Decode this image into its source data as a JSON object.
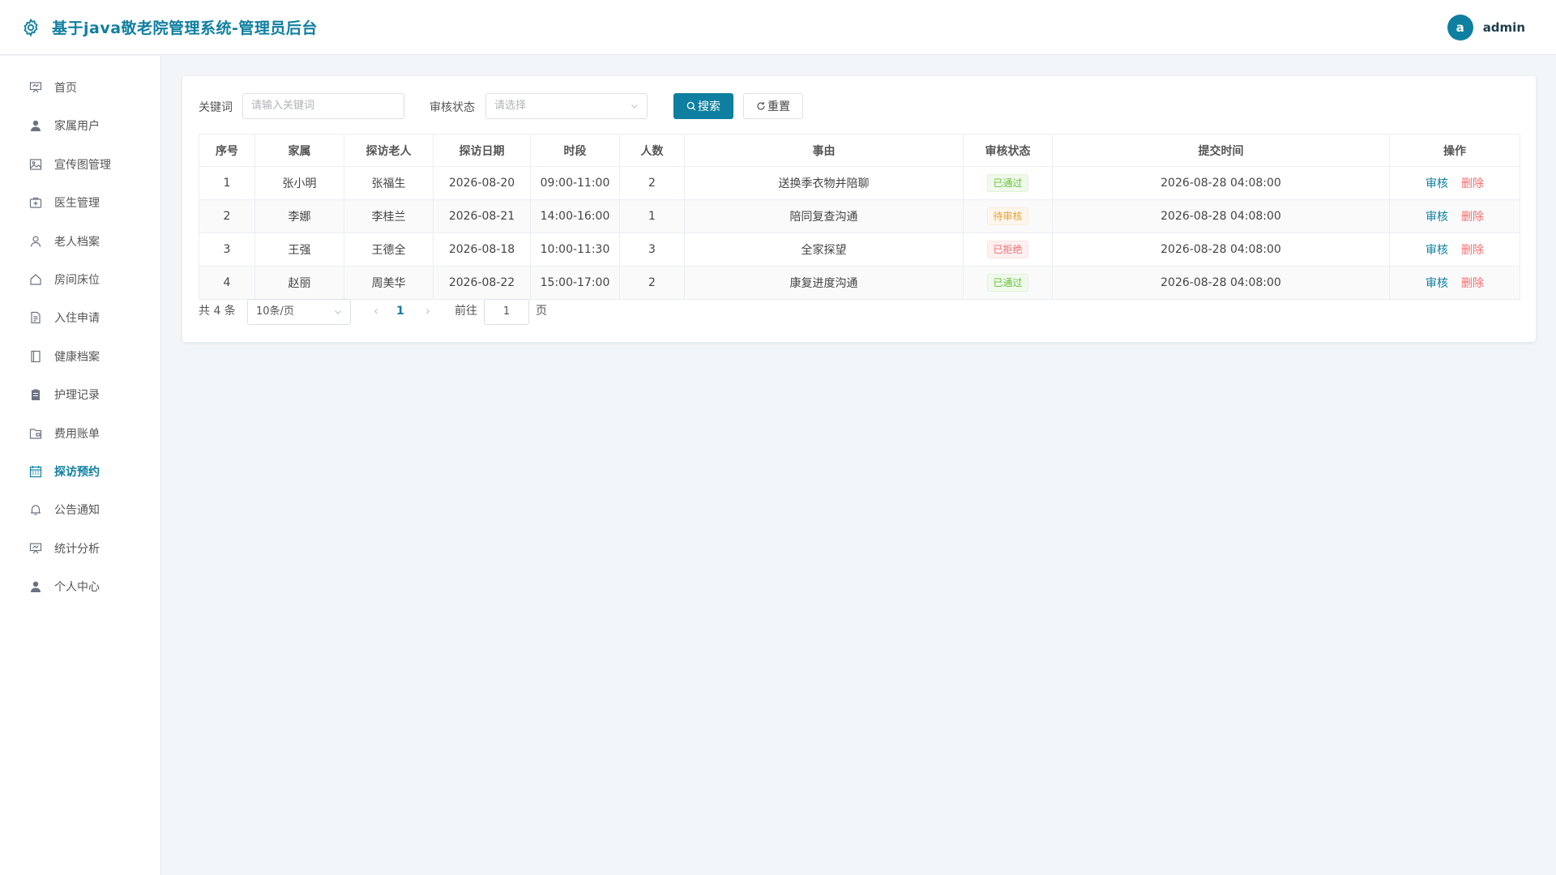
{
  "header": {
    "title": "基于java敬老院管理系统-管理员后台",
    "user_initial": "a",
    "username": "admin"
  },
  "sidebar": {
    "items": [
      {
        "label": "首页",
        "icon": "home-board-icon"
      },
      {
        "label": "家属用户",
        "icon": "user-solid-icon"
      },
      {
        "label": "宣传图管理",
        "icon": "picture-icon"
      },
      {
        "label": "医生管理",
        "icon": "first-aid-kit-icon"
      },
      {
        "label": "老人档案",
        "icon": "user-icon"
      },
      {
        "label": "房间床位",
        "icon": "house-icon"
      },
      {
        "label": "入住申请",
        "icon": "document-icon"
      },
      {
        "label": "健康档案",
        "icon": "notebook-icon"
      },
      {
        "label": "护理记录",
        "icon": "clipboard-icon"
      },
      {
        "label": "费用账单",
        "icon": "wallet-folder-icon"
      },
      {
        "label": "探访预约",
        "icon": "calendar-icon",
        "active": true
      },
      {
        "label": "公告通知",
        "icon": "bell-icon"
      },
      {
        "label": "统计分析",
        "icon": "data-board-icon"
      },
      {
        "label": "个人中心",
        "icon": "user-solid-icon"
      }
    ]
  },
  "filters": {
    "keyword_label": "关键词",
    "keyword_placeholder": "请输入关键词",
    "status_label": "审核状态",
    "status_placeholder": "请选择",
    "search_label": "搜索",
    "reset_label": "重置"
  },
  "table": {
    "columns": [
      "序号",
      "家属",
      "探访老人",
      "探访日期",
      "时段",
      "人数",
      "事由",
      "审核状态",
      "提交时间",
      "操作"
    ],
    "rows": [
      {
        "no": "1",
        "family": "张小明",
        "elder": "张福生",
        "date": "2026-08-20",
        "slot": "09:00-11:00",
        "count": "2",
        "reason": "送换季衣物并陪聊",
        "status": "已通过",
        "status_type": "success",
        "submitted": "2026-08-28 04:08:00"
      },
      {
        "no": "2",
        "family": "李娜",
        "elder": "李桂兰",
        "date": "2026-08-21",
        "slot": "14:00-16:00",
        "count": "1",
        "reason": "陪同复查沟通",
        "status": "待审核",
        "status_type": "warning",
        "submitted": "2026-08-28 04:08:00"
      },
      {
        "no": "3",
        "family": "王强",
        "elder": "王德全",
        "date": "2026-08-18",
        "slot": "10:00-11:30",
        "count": "3",
        "reason": "全家探望",
        "status": "已拒绝",
        "status_type": "danger",
        "submitted": "2026-08-28 04:08:00"
      },
      {
        "no": "4",
        "family": "赵丽",
        "elder": "周美华",
        "date": "2026-08-22",
        "slot": "15:00-17:00",
        "count": "2",
        "reason": "康复进度沟通",
        "status": "已通过",
        "status_type": "success",
        "submitted": "2026-08-28 04:08:00"
      }
    ],
    "actions": {
      "audit": "审核",
      "delete": "删除"
    }
  },
  "pagination": {
    "total_text": "共 4 条",
    "page_size": "10条/页",
    "current_page": "1",
    "goto_label": "前往",
    "goto_value": "1",
    "goto_unit": "页"
  },
  "colors": {
    "accent": "#0e7fa0",
    "success_text": "#67c23a",
    "success_bg": "#f0f9eb",
    "success_border": "#e1f3d8",
    "warning_text": "#e6a23c",
    "warning_bg": "#fdf6ec",
    "warning_border": "#faecd8",
    "danger_text": "#f56c6c",
    "danger_bg": "#fef0f0",
    "danger_border": "#fde2e2"
  }
}
